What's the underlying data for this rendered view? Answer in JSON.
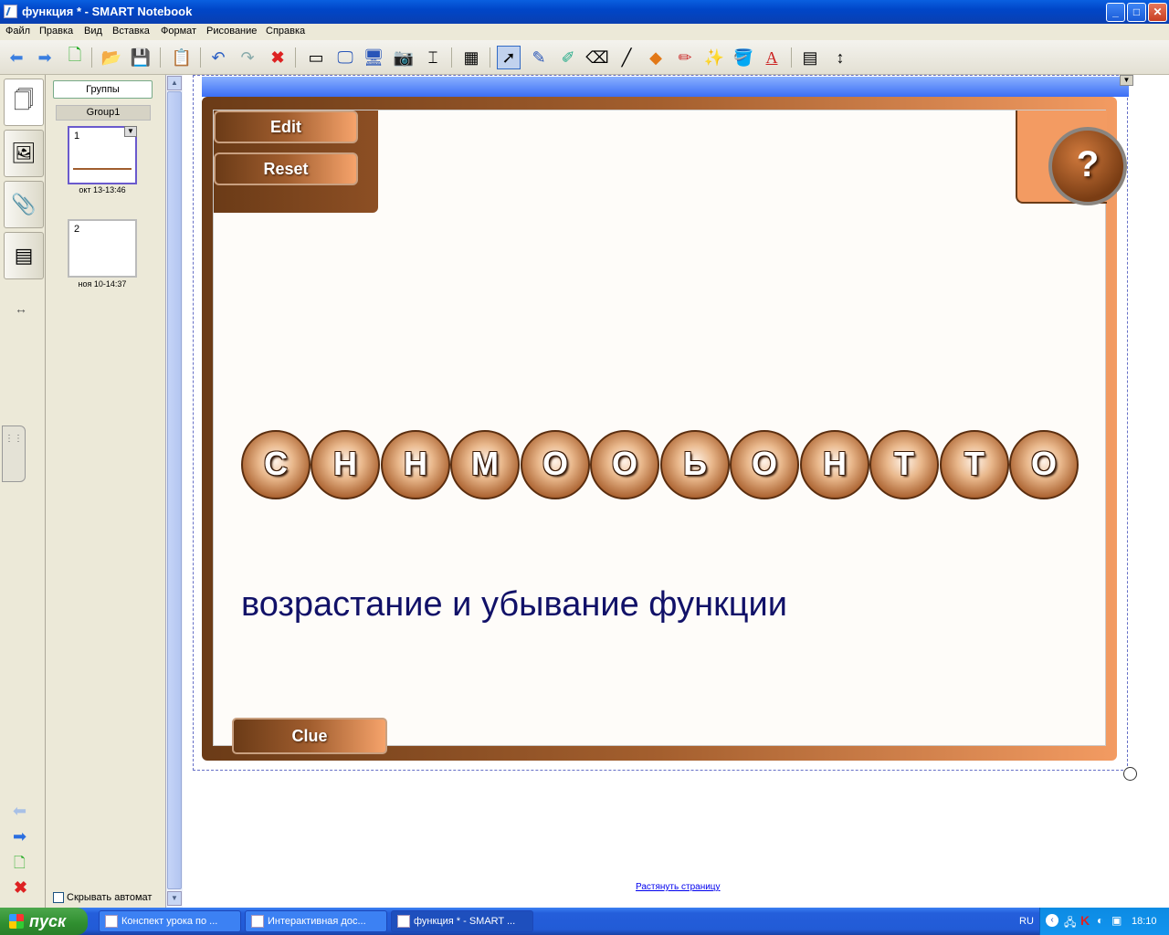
{
  "window": {
    "title": "функция * - SMART Notebook",
    "min": "_",
    "max": "□",
    "close": "✕"
  },
  "menu": [
    "Файл",
    "Правка",
    "Вид",
    "Вставка",
    "Формат",
    "Рисование",
    "Справка"
  ],
  "toolbar_icons": [
    "back-icon",
    "forward-icon",
    "add-page-icon",
    "open-icon",
    "save-icon",
    "paste-icon",
    "undo-icon",
    "redo-icon",
    "delete-icon",
    "screen-shade-icon",
    "full-screen-icon",
    "dual-display-icon",
    "capture-icon",
    "document-camera-icon",
    "table-icon",
    "select-icon",
    "pen-icon",
    "creative-pen-icon",
    "eraser-icon",
    "line-icon",
    "shapes-icon",
    "magic-pen-icon",
    "highlighter-icon",
    "fill-icon",
    "text-icon",
    "properties-icon",
    "move-toolbar-icon"
  ],
  "sorter": {
    "groups_label": "Группы",
    "group_name": "Group1",
    "pages": [
      {
        "number": "1",
        "caption": "окт 13-13:46"
      },
      {
        "number": "2",
        "caption": "ноя 10-14:37"
      }
    ],
    "autohide_label": "Скрывать автомат"
  },
  "lesson": {
    "edit_label": "Edit",
    "reset_label": "Reset",
    "help_label": "?",
    "letters": [
      "С",
      "Н",
      "Н",
      "М",
      "О",
      "О",
      "Ь",
      "О",
      "Н",
      "Т",
      "Т",
      "О"
    ],
    "clue_text": "возрастание и убывание функции",
    "clue_button": "Clue"
  },
  "expand_page_link": "Растянуть страницу",
  "taskbar": {
    "start_label": "пуск",
    "tasks": [
      {
        "label": "Конспект урока по ..."
      },
      {
        "label": "Интерактивная дос..."
      },
      {
        "label": "функция * - SMART ..."
      }
    ],
    "lang": "RU",
    "clock": "18:10"
  },
  "colors": {
    "frame_dark": "#6b3b17",
    "frame_light": "#f39b62",
    "clue_text": "#111168",
    "titlebar": "#0a5fe0"
  }
}
